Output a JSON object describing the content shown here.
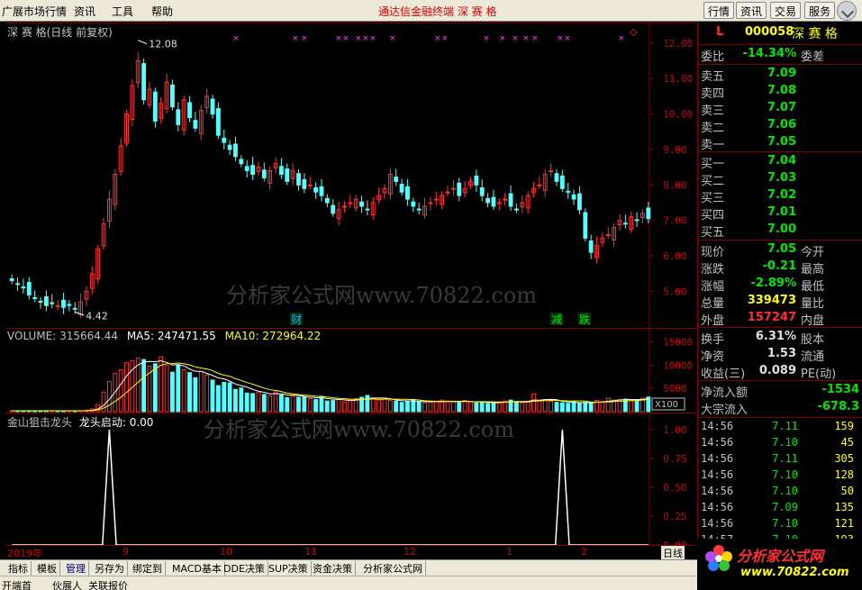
{
  "menu": {
    "app": "广展市场行情",
    "items": [
      "资讯",
      "工具",
      "帮助"
    ],
    "center": "通达信金融终端  深 赛 格",
    "right_buttons": [
      "行情",
      "资讯",
      "交易",
      "服务"
    ]
  },
  "kchart": {
    "title": "深 赛 格(日线 前复权)",
    "high_label": "12.08",
    "low_label": "4.42",
    "y_ticks": [
      "12.00",
      "11.00",
      "10.00",
      "9.00",
      "8.00",
      "7.00",
      "6.00",
      "5.00"
    ],
    "events": [
      {
        "text": "财",
        "color": "#00aaff"
      },
      {
        "text": "减",
        "color": "#00e600"
      },
      {
        "text": "跌",
        "color": "#00e600"
      }
    ],
    "watermark": "分析家公式网www.70822.com"
  },
  "volume": {
    "label": "VOLUME: 315664.44",
    "ma5": "MA5: 247471.55",
    "ma10": "MA10: 272964.22",
    "y_ticks": [
      "15000",
      "10000",
      "5000"
    ],
    "unit": "X100"
  },
  "indicator": {
    "title": "金山狙击龙头",
    "sub": "龙头启动: 0.00",
    "y_ticks": [
      "1.00",
      "0.75",
      "0.50",
      "0.25",
      "0.00"
    ],
    "watermark": "分析家公式网www.70822.com"
  },
  "quote": {
    "letter": "L",
    "code": "000058",
    "name": "深 赛 格",
    "weibi": {
      "label": "委比",
      "value": "-14.34%",
      "right": "委差"
    },
    "asks": [
      {
        "label": "卖五",
        "price": "7.09"
      },
      {
        "label": "卖四",
        "price": "7.08"
      },
      {
        "label": "卖三",
        "price": "7.07"
      },
      {
        "label": "卖二",
        "price": "7.06"
      },
      {
        "label": "卖一",
        "price": "7.05"
      }
    ],
    "bids": [
      {
        "label": "买一",
        "price": "7.04"
      },
      {
        "label": "买二",
        "price": "7.03"
      },
      {
        "label": "买三",
        "price": "7.02"
      },
      {
        "label": "买四",
        "price": "7.01"
      },
      {
        "label": "买五",
        "price": "7.00"
      }
    ],
    "stats1": [
      {
        "label": "现价",
        "value": "7.05",
        "right": "今开",
        "cls": "g"
      },
      {
        "label": "涨跌",
        "value": "-0.21",
        "right": "最高",
        "cls": "g"
      },
      {
        "label": "涨幅",
        "value": "-2.89%",
        "right": "最低",
        "cls": "g"
      },
      {
        "label": "总量",
        "value": "339473",
        "right": "量比",
        "cls": "y"
      },
      {
        "label": "外盘",
        "value": "157247",
        "right": "内盘",
        "cls": "rd"
      }
    ],
    "stats2": [
      {
        "label": "换手",
        "value": "6.31%",
        "right": "股本",
        "cls": "w"
      },
      {
        "label": "净资",
        "value": "1.53",
        "right": "流通",
        "cls": "w"
      },
      {
        "label": "收益(三)",
        "value": "0.089",
        "right": "PE(动)",
        "cls": "w"
      }
    ],
    "flow": [
      {
        "label": "净流入额",
        "value": "-1534"
      },
      {
        "label": "大宗流入",
        "value": "-678.3"
      }
    ],
    "ticks": [
      {
        "t": "14:56",
        "p": "7.11",
        "q": "159"
      },
      {
        "t": "14:56",
        "p": "7.10",
        "q": "45"
      },
      {
        "t": "14:56",
        "p": "7.11",
        "q": "305"
      },
      {
        "t": "14:56",
        "p": "7.10",
        "q": "128"
      },
      {
        "t": "14:56",
        "p": "7.10",
        "q": "50"
      },
      {
        "t": "14:56",
        "p": "7.09",
        "q": "135"
      },
      {
        "t": "14:56",
        "p": "7.10",
        "q": "121"
      },
      {
        "t": "14:57",
        "p": "7.10",
        "q": "193"
      }
    ]
  },
  "dates": [
    "2019年",
    "9",
    "10",
    "11",
    "12",
    "1",
    "2",
    "日线"
  ],
  "tabs": [
    "指标",
    "模板",
    "管理",
    "另存为",
    "绑定到",
    "MACD基本",
    "DDE决策",
    "SUP决策",
    "资金决策",
    "分析家公式网"
  ],
  "tabs2": [
    "开端首",
    "伙展人",
    "关联报价"
  ],
  "logo": {
    "text": "分析家公式网",
    "url": "www.70822.com"
  },
  "colors": {
    "up": "#ff3232",
    "down": "#54ffff",
    "ma5": "#ffffff",
    "ma10": "#ffff00",
    "grid": "#800000"
  },
  "chart_data": {
    "type": "candlestick",
    "ylim": [
      4.3,
      12.3
    ],
    "closes": [
      5.3,
      5.2,
      5.1,
      4.9,
      4.8,
      4.7,
      4.6,
      4.65,
      4.6,
      4.55,
      4.6,
      4.5,
      4.7,
      5.0,
      5.5,
      6.2,
      6.9,
      7.6,
      8.3,
      9.1,
      10.0,
      10.8,
      11.5,
      10.4,
      10.7,
      9.8,
      10.3,
      10.9,
      10.2,
      9.7,
      10.4,
      9.9,
      9.6,
      10.1,
      10.5,
      10.0,
      9.4,
      9.2,
      9.0,
      8.8,
      8.6,
      8.4,
      8.3,
      8.5,
      8.2,
      8.4,
      8.6,
      8.3,
      8.1,
      8.4,
      8.0,
      7.9,
      8.0,
      7.8,
      7.7,
      7.5,
      7.2,
      7.3,
      7.4,
      7.5,
      7.6,
      7.4,
      7.3,
      7.5,
      7.7,
      7.9,
      8.3,
      8.1,
      7.8,
      7.6,
      7.4,
      7.3,
      7.4,
      7.5,
      7.6,
      7.7,
      7.8,
      7.9,
      7.7,
      7.9,
      8.1,
      8.0,
      7.7,
      7.5,
      7.4,
      7.5,
      7.6,
      7.4,
      7.3,
      7.5,
      7.7,
      7.9,
      8.0,
      8.3,
      8.4,
      8.1,
      7.9,
      7.8,
      7.6,
      7.3,
      6.5,
      6.1,
      6.3,
      6.5,
      6.6,
      6.8,
      7.0,
      6.9,
      7.1,
      7.0,
      7.2,
      7.05
    ],
    "volumes": [
      200,
      200,
      200,
      200,
      200,
      200,
      200,
      200,
      200,
      200,
      200,
      200,
      200,
      300,
      600,
      1500,
      4200,
      6500,
      8200,
      9000,
      10500,
      11000,
      11500,
      11200,
      9800,
      10300,
      11800,
      9900,
      8500,
      10100,
      9000,
      8400,
      7300,
      8600,
      7900,
      6800,
      5600,
      6300,
      6200,
      4800,
      5100,
      4000,
      3900,
      4100,
      3700,
      3400,
      4300,
      3600,
      3000,
      3400,
      3100,
      3200,
      2800,
      2600,
      3300,
      2300,
      2400,
      2600,
      2100,
      2500,
      2800,
      3100,
      3500,
      2800,
      2500,
      2700,
      2400,
      2300,
      2000,
      2200,
      2600,
      2100,
      1900,
      2000,
      2200,
      2500,
      2300,
      2100,
      2000,
      2400,
      2100,
      1900,
      2000,
      1800,
      1900,
      2100,
      2300,
      2500,
      2100,
      1900,
      2200,
      3800,
      2400,
      2600,
      2200,
      2000,
      1900,
      1800,
      2100,
      1900,
      2000,
      1800,
      2400,
      2200,
      2900,
      2500,
      2600,
      2700,
      2400,
      2600,
      2900,
      3156
    ],
    "signal_indices": [
      17,
      96
    ]
  }
}
